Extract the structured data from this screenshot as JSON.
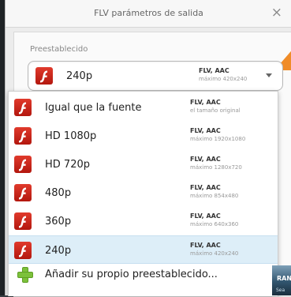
{
  "dialog": {
    "title": "FLV parámetros de salida",
    "close_glyph": "×"
  },
  "preset": {
    "label": "Preestablecido",
    "selected": {
      "name": "240p",
      "format": "FLV, AAC",
      "detail": "máximo 420x240",
      "icon": "flash-icon"
    }
  },
  "menu": {
    "items": [
      {
        "name": "Igual que la fuente",
        "format": "FLV, AAC",
        "detail": "el tamaño original",
        "icon": "flash-icon"
      },
      {
        "name": "HD 1080p",
        "format": "FLV, AAC",
        "detail": "máximo 1920x1080",
        "icon": "flash-icon"
      },
      {
        "name": "HD 720p",
        "format": "FLV, AAC",
        "detail": "máximo 1280x720",
        "icon": "flash-icon"
      },
      {
        "name": "480p",
        "format": "FLV, AAC",
        "detail": "máximo 854x480",
        "icon": "flash-icon"
      },
      {
        "name": "360p",
        "format": "FLV, AAC",
        "detail": "máximo 640x360",
        "icon": "flash-icon"
      },
      {
        "name": "240p",
        "format": "FLV, AAC",
        "detail": "máximo 420x240",
        "icon": "flash-icon",
        "selected": true
      }
    ],
    "add_label": "Añadir su propio preestablecido...",
    "add_icon": "plus-icon"
  },
  "background_thumb": {
    "text_top": "RAN",
    "text_bottom": "Sea"
  },
  "colors": {
    "flash_red": "#c8261a",
    "selection": "#ddeef8",
    "accent_orange": "#f08c28",
    "plus_green": "#7cc13b"
  }
}
